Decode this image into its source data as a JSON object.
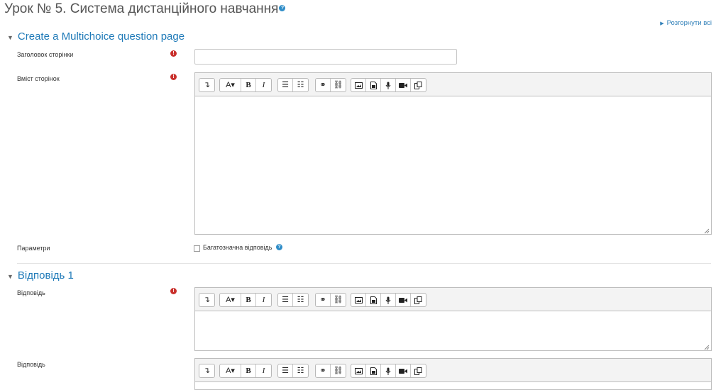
{
  "page": {
    "title": "Урок № 5. Система дистанційного навчання",
    "expand_all": "Розгорнути всі"
  },
  "section1": {
    "title": "Create a Multichoice question page",
    "page_title_label": "Заголовок сторінки",
    "page_content_label": "Вміст сторінок",
    "options_label": "Параметри",
    "multiple_answer_label": "Багатозначна відповідь"
  },
  "section2": {
    "title": "Відповідь 1",
    "answer_label": "Відповідь",
    "answer2_label": "Відповідь"
  },
  "icons": {
    "help": "help-icon",
    "required": "required-icon",
    "collapse": "caret-down-icon"
  },
  "colors": {
    "accent": "#1f7ab8",
    "required": "#c9302c"
  }
}
